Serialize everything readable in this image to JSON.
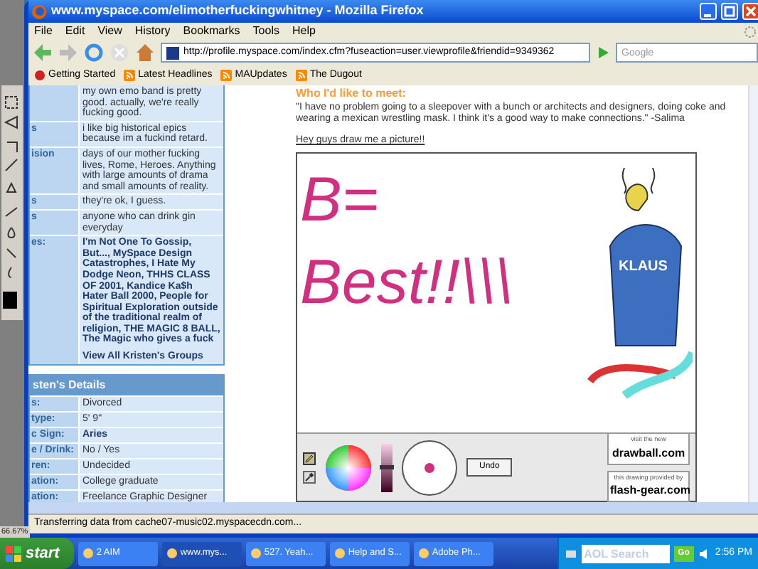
{
  "desktop": {
    "zoom_level": "66.67%"
  },
  "window": {
    "title": "www.myspace.com/elimotherfuckingwhitney - Mozilla Firefox"
  },
  "menu": [
    "File",
    "Edit",
    "View",
    "History",
    "Bookmarks",
    "Tools",
    "Help"
  ],
  "toolbar": {
    "url": "http://profile.myspace.com/index.cfm?fuseaction=user.viewprofile&friendid=9349362",
    "search_placeholder": "Google"
  },
  "bookmarks": [
    "Getting Started",
    "Latest Headlines",
    "MAUpdates",
    "The Dugout"
  ],
  "interests": [
    {
      "value": "my own emo band is pretty good. actually, we're really fucking good."
    },
    {
      "label": "s",
      "value": "i like big historical epics because im a fuckind retard."
    },
    {
      "label": "ision",
      "value": "days of our mother fucking lives, Rome, Heroes. Anything with large amounts of drama and small amounts of reality."
    },
    {
      "label": "s",
      "value": "they're ok, I guess."
    },
    {
      "label": "s",
      "value": "anyone who can drink gin everyday"
    },
    {
      "label": "es:",
      "value": "I'm Not One To Gossip, But..., MySpace Design Catastrophes, I Hate My Dodge Neon, THHS CLASS OF 2001, Kandice Ka$h Hater Ball 2000, People for Spiritual Exploration outside of the traditional realm of religion, THE MAGIC 8 BALL, The Magic who gives a fuck",
      "link": "View All Kristen's Groups"
    }
  ],
  "details": {
    "title": "sten's Details",
    "rows": [
      {
        "label": "s:",
        "value": "Divorced",
        "bold": false
      },
      {
        "label": "type:",
        "value": "5' 9\"",
        "bold": false
      },
      {
        "label": "c Sign:",
        "value": "Aries",
        "bold": true
      },
      {
        "label": "e / Drink:",
        "value": "No / Yes",
        "bold": false
      },
      {
        "label": "ren:",
        "value": "Undecided",
        "bold": false
      },
      {
        "label": "ation:",
        "value": "College graduate",
        "bold": false
      },
      {
        "label": "ation:",
        "value": "Freelance Graphic Designer",
        "bold": false
      }
    ]
  },
  "profile": {
    "heading": "Who I'd like to meet:",
    "quote": "\"I have no problem going to a sleepover with a bunch or architects and designers, doing coke and wearing a mexican wrestling mask. I think it's a good way to make connections.\" -Salima",
    "prompt": "Hey guys draw me a picture!!"
  },
  "drawing": {
    "lines": [
      "B=",
      "Best!!\\\\\\"
    ],
    "figure_label": "KLAUS",
    "tools": [
      {
        "kind": "pencil",
        "selected": true
      },
      {
        "kind": "eyedropper",
        "selected": false
      }
    ],
    "brightness": {
      "level": 0.5
    },
    "undo": "Undo",
    "promos": [
      {
        "small": "visit the new",
        "big": "drawball.com"
      },
      {
        "small": "this drawing provided by",
        "big": "flash-gear.com"
      }
    ]
  },
  "status": "Transferring data from cache07-music02.myspacecdn.com...",
  "taskbar": {
    "start": "start",
    "tasks": [
      {
        "label": "2 AIM",
        "selected": false
      },
      {
        "label": "www.mys...",
        "selected": true
      },
      {
        "label": "527. Yeah...",
        "selected": false
      },
      {
        "label": "Help and S...",
        "selected": false
      },
      {
        "label": "Adobe Ph...",
        "selected": false
      }
    ],
    "search_placeholder": "AOL Search",
    "go": "Go",
    "clock": "2:56 PM"
  }
}
